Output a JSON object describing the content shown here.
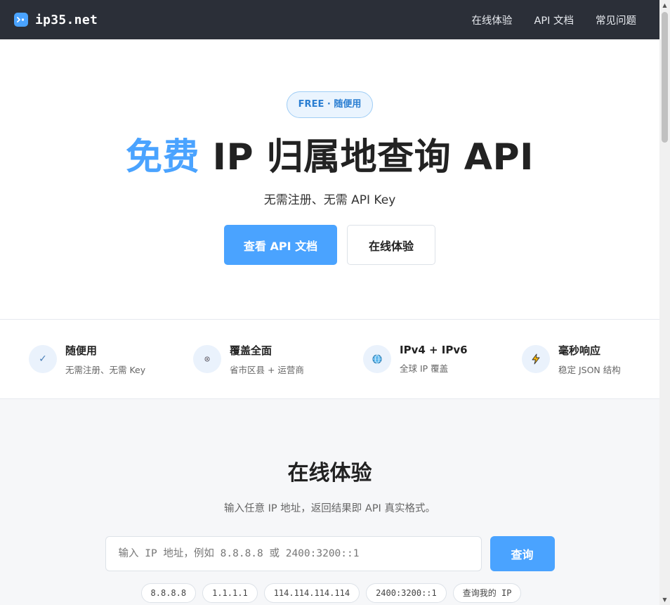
{
  "header": {
    "brand": "ip35.net",
    "nav": [
      "在线体验",
      "API 文档",
      "常见问题"
    ]
  },
  "hero": {
    "badge": "FREE · 随便用",
    "title_accent": "免费",
    "title_rest": " IP 归属地查询 API",
    "subtitle": "无需注册、无需 API Key",
    "primary_button": "查看 API 文档",
    "secondary_button": "在线体验"
  },
  "features": [
    {
      "icon": "check-icon",
      "glyph": "✓",
      "title": "随便用",
      "desc": "无需注册、无需 Key"
    },
    {
      "icon": "location-pin-icon",
      "glyph": "●",
      "title": "覆盖全面",
      "desc": "省市区县 + 运营商"
    },
    {
      "icon": "globe-icon",
      "glyph": "🌐",
      "title": "IPv4 + IPv6",
      "desc": "全球 IP 覆盖"
    },
    {
      "icon": "lightning-icon",
      "glyph": "⚡",
      "title": "毫秒响应",
      "desc": "稳定 JSON 结构"
    }
  ],
  "tryout": {
    "title": "在线体验",
    "subtitle": "输入任意 IP 地址，返回结果即 API 真实格式。",
    "input_placeholder": "输入 IP 地址，例如 8.8.8.8 或 2400:3200::1",
    "input_value": "",
    "query_button": "查询",
    "chips": [
      "8.8.8.8",
      "1.1.1.1",
      "114.114.114.114",
      "2400:3200::1",
      "查询我的 IP"
    ]
  },
  "colors": {
    "accent": "#4aa3ff",
    "header_bg": "#2b2f38"
  }
}
